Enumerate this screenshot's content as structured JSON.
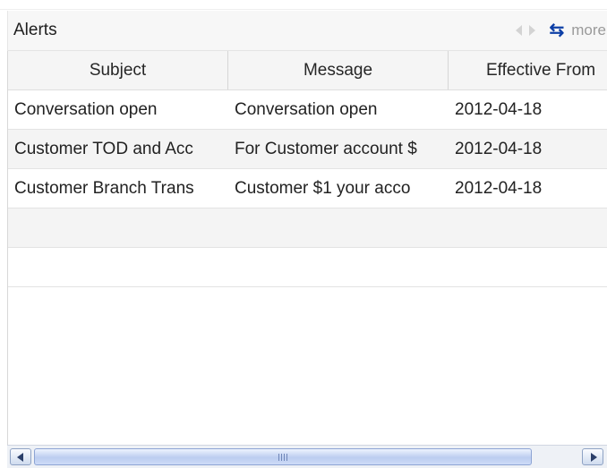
{
  "panel": {
    "title": "Alerts",
    "more_label": "more",
    "icons": {
      "prev": "prev-arrow-icon",
      "next": "next-arrow-icon",
      "refresh": "refresh-icon"
    }
  },
  "grid": {
    "columns": [
      "Subject",
      "Message",
      "Effective From"
    ],
    "rows": [
      {
        "subject": "Conversation open",
        "message": "Conversation open",
        "effective_from": "2012-04-18"
      },
      {
        "subject": "Customer TOD and Acc",
        "message": "For Customer account $",
        "effective_from": "2012-04-18"
      },
      {
        "subject": "Customer Branch Trans",
        "message": "Customer $1 your acco",
        "effective_from": "2012-04-18"
      }
    ],
    "empty_rows": 2
  },
  "colors": {
    "header_bg": "#f7f7f7",
    "accent": "#0d3fa6",
    "row_alt": "#f4f4f4"
  }
}
